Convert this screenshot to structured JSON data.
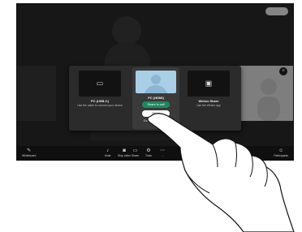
{
  "top": {
    "status": ""
  },
  "dialog": {
    "left": {
      "title": "PC (USB-C)",
      "desc": "Use the cable to connect your device"
    },
    "middle": {
      "title": "PC (HDMI)",
      "call_label": "Share in call",
      "show_label": "Show",
      "note": "Show ms in front of ..."
    },
    "right": {
      "title": "Webex Share",
      "desc": "Use the Webex app"
    }
  },
  "bottombar": {
    "left": "Whiteboard",
    "items": [
      "Mute",
      "Stop video",
      "Share",
      "Tools",
      "..."
    ],
    "right": "Participants"
  },
  "icons": {
    "left_tile": "laptop-icon",
    "right_tile": "screen-share-icon",
    "whiteboard": "pen-icon",
    "participants": "people-icon"
  }
}
